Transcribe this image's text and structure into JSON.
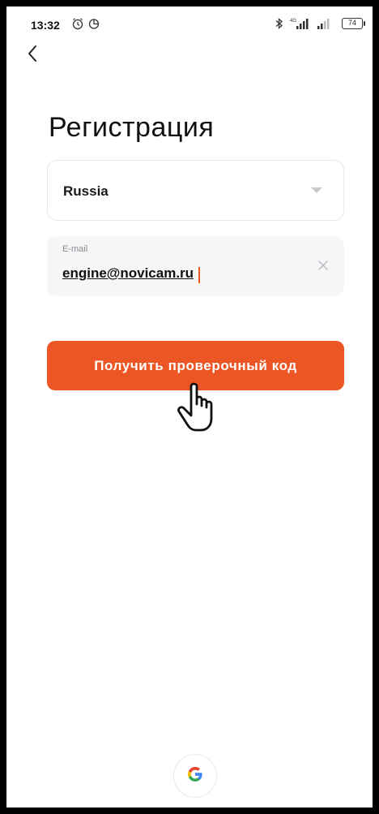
{
  "status_bar": {
    "time": "13:32",
    "battery": "74",
    "network": "4G",
    "icons": [
      "alarm-icon",
      "data-saver-icon",
      "bluetooth-icon",
      "signal-icon",
      "battery-icon"
    ]
  },
  "nav": {
    "back_icon": "chevron-left-icon"
  },
  "page": {
    "title": "Регистрация"
  },
  "country": {
    "value": "Russia",
    "icon": "dropdown-triangle-icon"
  },
  "email": {
    "label": "E-mail",
    "value": "engine@novicam.ru",
    "clear_icon": "clear-x-icon"
  },
  "submit": {
    "label": "Получить проверочный код"
  },
  "social": {
    "google_icon": "google-icon"
  },
  "colors": {
    "accent": "#ec5625",
    "caret": "#ee5522",
    "field_bg": "#f5f6f8",
    "border": "#e6e6e6",
    "text": "#111111"
  }
}
